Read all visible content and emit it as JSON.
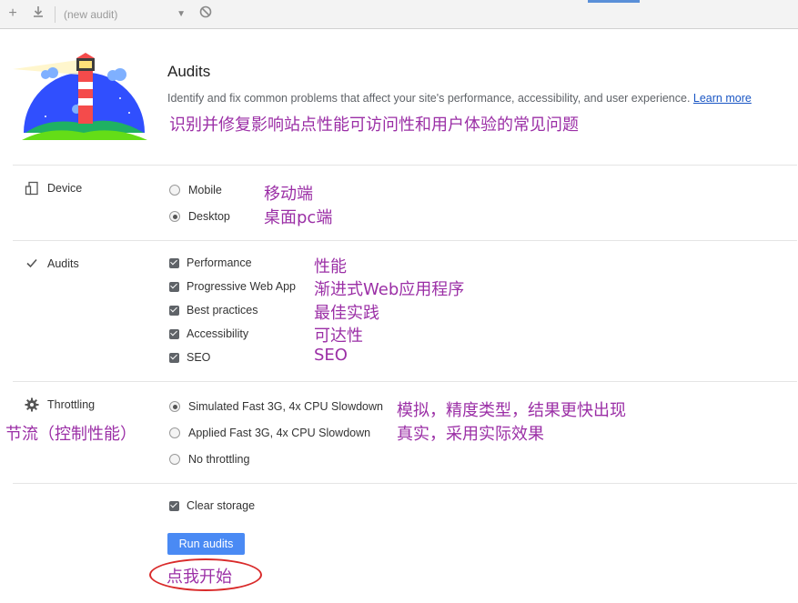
{
  "toolbar": {
    "add_icon": "plus-icon",
    "download_icon": "download-icon",
    "select_value": "(new audit)",
    "clear_icon": "block-icon"
  },
  "header": {
    "title": "Audits",
    "description": "Identify and fix common problems that affect your site's performance, accessibility, and user experience.",
    "learn_more": "Learn more",
    "note": "识别并修复影响站点性能可访问性和用户体验的常见问题"
  },
  "device": {
    "label": "Device",
    "options": [
      {
        "label": "Mobile",
        "note": "移动端",
        "selected": false
      },
      {
        "label": "Desktop",
        "note": "桌面pc端",
        "selected": true
      }
    ]
  },
  "audits": {
    "label": "Audits",
    "items": [
      {
        "label": "Performance",
        "note": "性能",
        "checked": true
      },
      {
        "label": "Progressive Web App",
        "note": "渐进式Web应用程序",
        "checked": true
      },
      {
        "label": "Best practices",
        "note": "最佳实践",
        "checked": true
      },
      {
        "label": "Accessibility",
        "note": "可达性",
        "checked": true
      },
      {
        "label": "SEO",
        "note": "SEO",
        "checked": true
      }
    ]
  },
  "throttling": {
    "label": "Throttling",
    "note": "节流（控制性能）",
    "options": [
      {
        "label": "Simulated Fast 3G, 4x CPU Slowdown",
        "note": "模拟，精度类型，结果更快出现",
        "selected": true
      },
      {
        "label": "Applied Fast 3G, 4x CPU Slowdown",
        "note": "真实，采用实际效果",
        "selected": false
      },
      {
        "label": "No throttling",
        "selected": false
      }
    ]
  },
  "storage": {
    "label": "Clear storage",
    "checked": true
  },
  "run": {
    "label": "Run audits",
    "note": "点我开始"
  },
  "colors": {
    "accent": "#4a8af4",
    "annotation": "#9b2fa6",
    "circle": "#d92a2a"
  }
}
